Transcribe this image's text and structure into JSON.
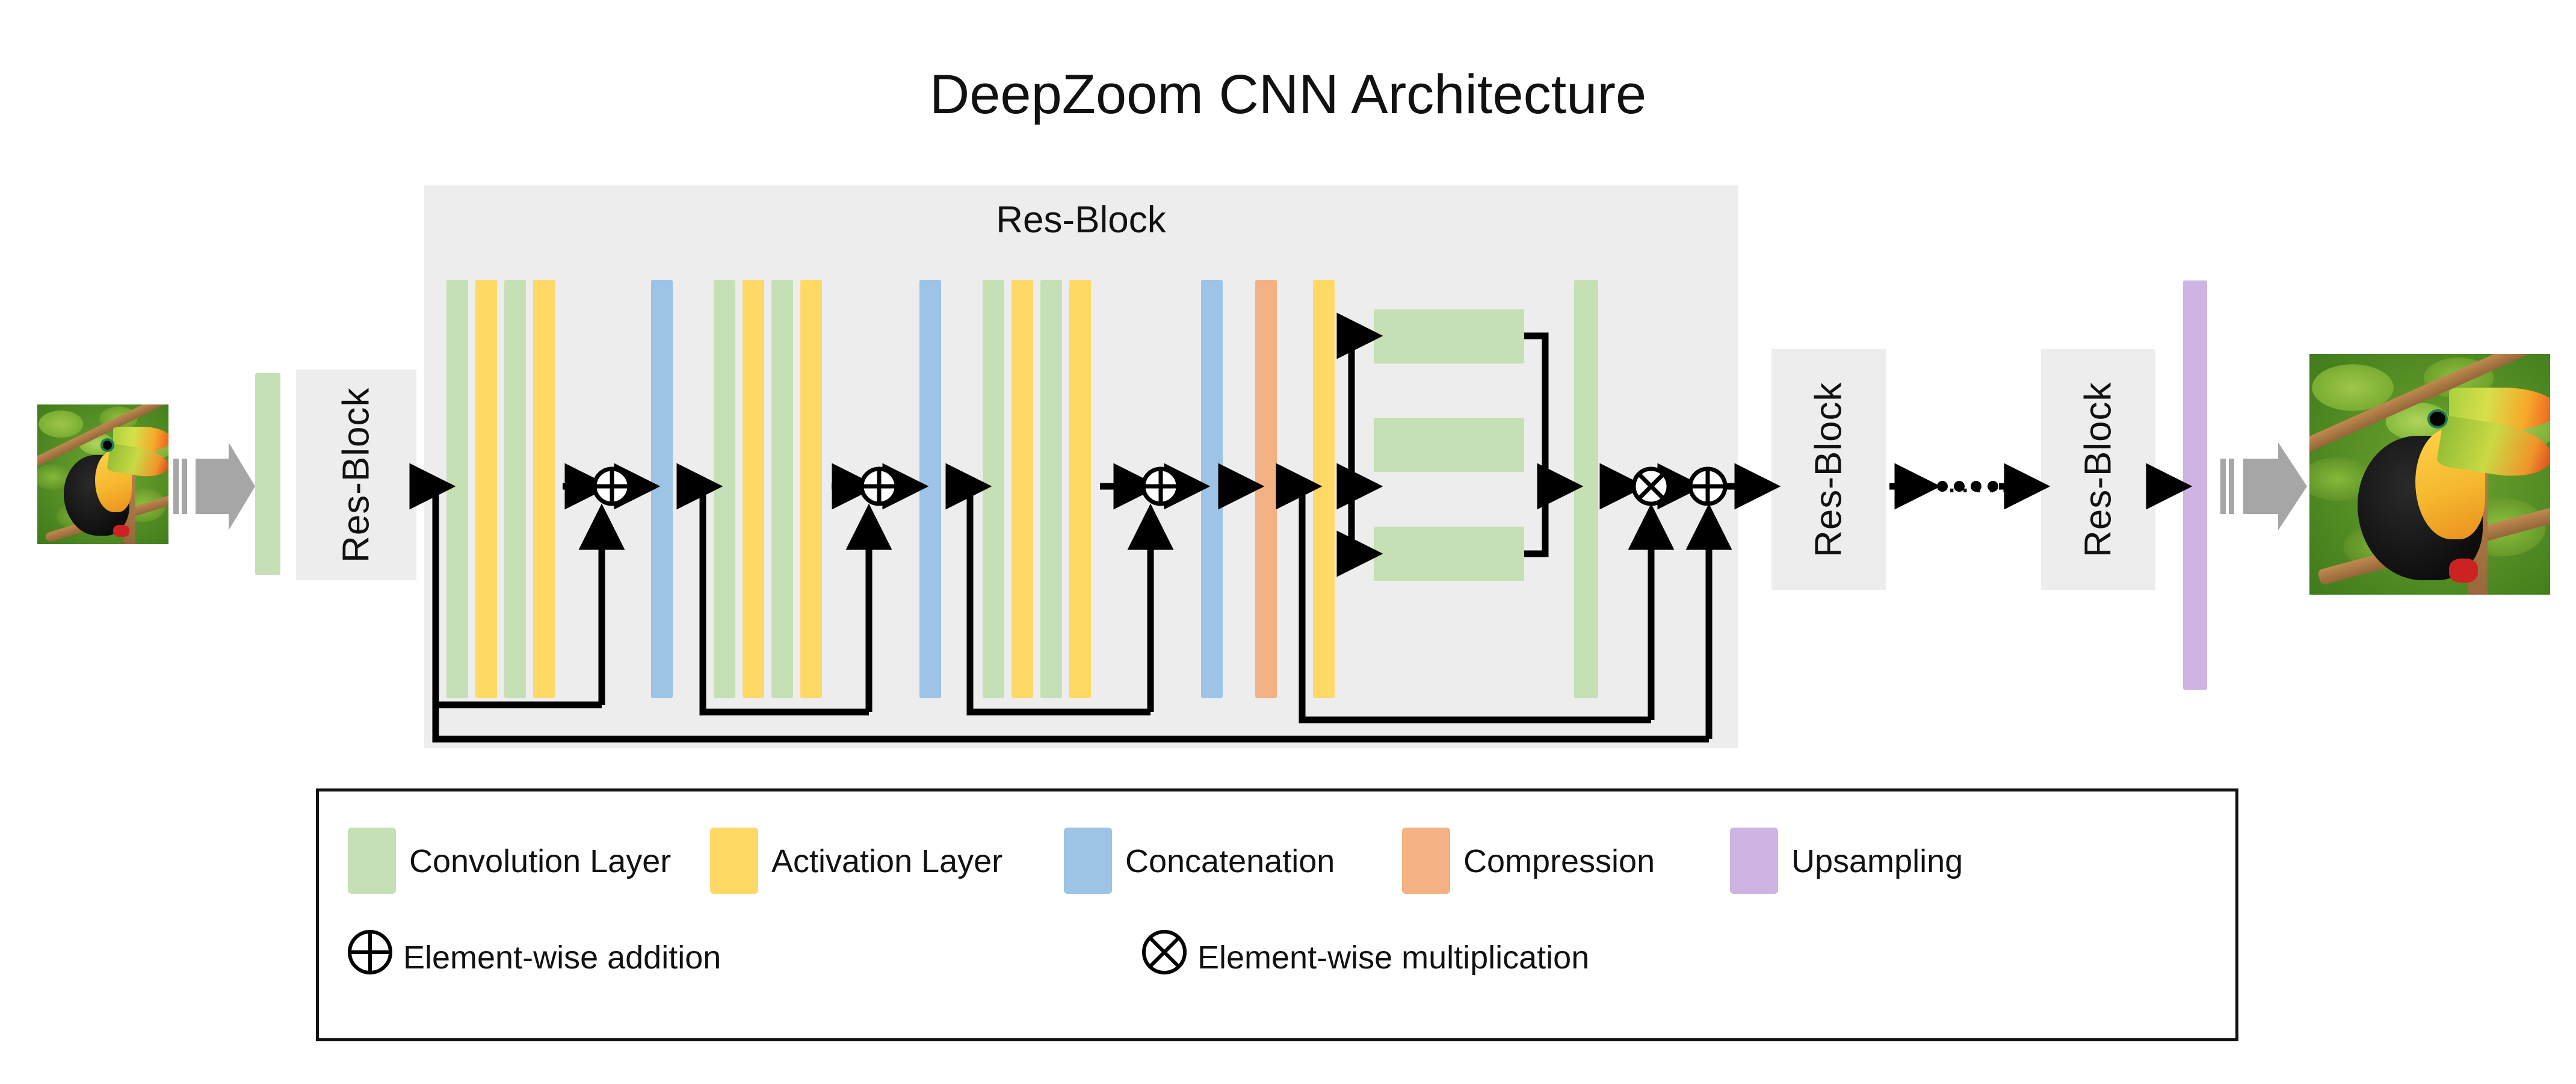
{
  "title": "DeepZoom CNN Architecture",
  "colors": {
    "convolution": "#C5E0B4",
    "activation": "#FFD966",
    "concatenation": "#9DC3E6",
    "compression": "#F4B183",
    "upsampling": "#CDB4E3",
    "panel_grey": "#EDEDED",
    "arrow_black": "#000000",
    "block_arrow_grey": "#A6A6A6",
    "background": "#FFFFFF"
  },
  "resblock_detail": {
    "panel_title": "Res-Block",
    "stages": [
      {
        "name": "dense-group-1",
        "layers": [
          "Convolution Layer",
          "Activation Layer",
          "Convolution Layer",
          "Activation Layer"
        ],
        "merge_op": "Element-wise addition",
        "tail": [
          "Concatenation"
        ]
      },
      {
        "name": "dense-group-2",
        "layers": [
          "Convolution Layer",
          "Activation Layer",
          "Convolution Layer",
          "Activation Layer"
        ],
        "merge_op": "Element-wise addition",
        "tail": [
          "Concatenation"
        ]
      },
      {
        "name": "dense-group-3",
        "layers": [
          "Convolution Layer",
          "Activation Layer",
          "Convolution Layer",
          "Activation Layer"
        ],
        "merge_op": "Element-wise addition",
        "tail": [
          "Concatenation",
          "Compression",
          "Activation Layer"
        ]
      },
      {
        "name": "multi-scale-attention",
        "branches": [
          "Convolution Layer",
          "Convolution Layer",
          "Convolution Layer"
        ],
        "fuse": [
          "Convolution Layer"
        ],
        "merge_ops": [
          "Element-wise multiplication",
          "Element-wise addition"
        ]
      }
    ]
  },
  "pipeline": {
    "input_image_alt": "toucan-input-photo",
    "input_arrow": "block-arrow-right",
    "head_conv": "Convolution Layer",
    "blocks": [
      "Res-Block",
      "Res-Block",
      "Res-Block"
    ],
    "ellipsis": "......",
    "tail_upsampling": "Upsampling",
    "output_arrow": "block-arrow-right",
    "output_image_alt": "toucan-output-photo"
  },
  "legend": {
    "swatches": [
      {
        "label": "Convolution Layer",
        "color": "#C5E0B4"
      },
      {
        "label": "Activation Layer",
        "color": "#FFD966"
      },
      {
        "label": "Concatenation",
        "color": "#9DC3E6"
      },
      {
        "label": "Compression",
        "color": "#F4B183"
      },
      {
        "label": "Upsampling",
        "color": "#CDB4E3"
      }
    ],
    "operators": [
      {
        "symbol": "plus-in-circle",
        "label": "Element-wise addition"
      },
      {
        "symbol": "times-in-circle",
        "label": "Element-wise multiplication"
      }
    ]
  }
}
